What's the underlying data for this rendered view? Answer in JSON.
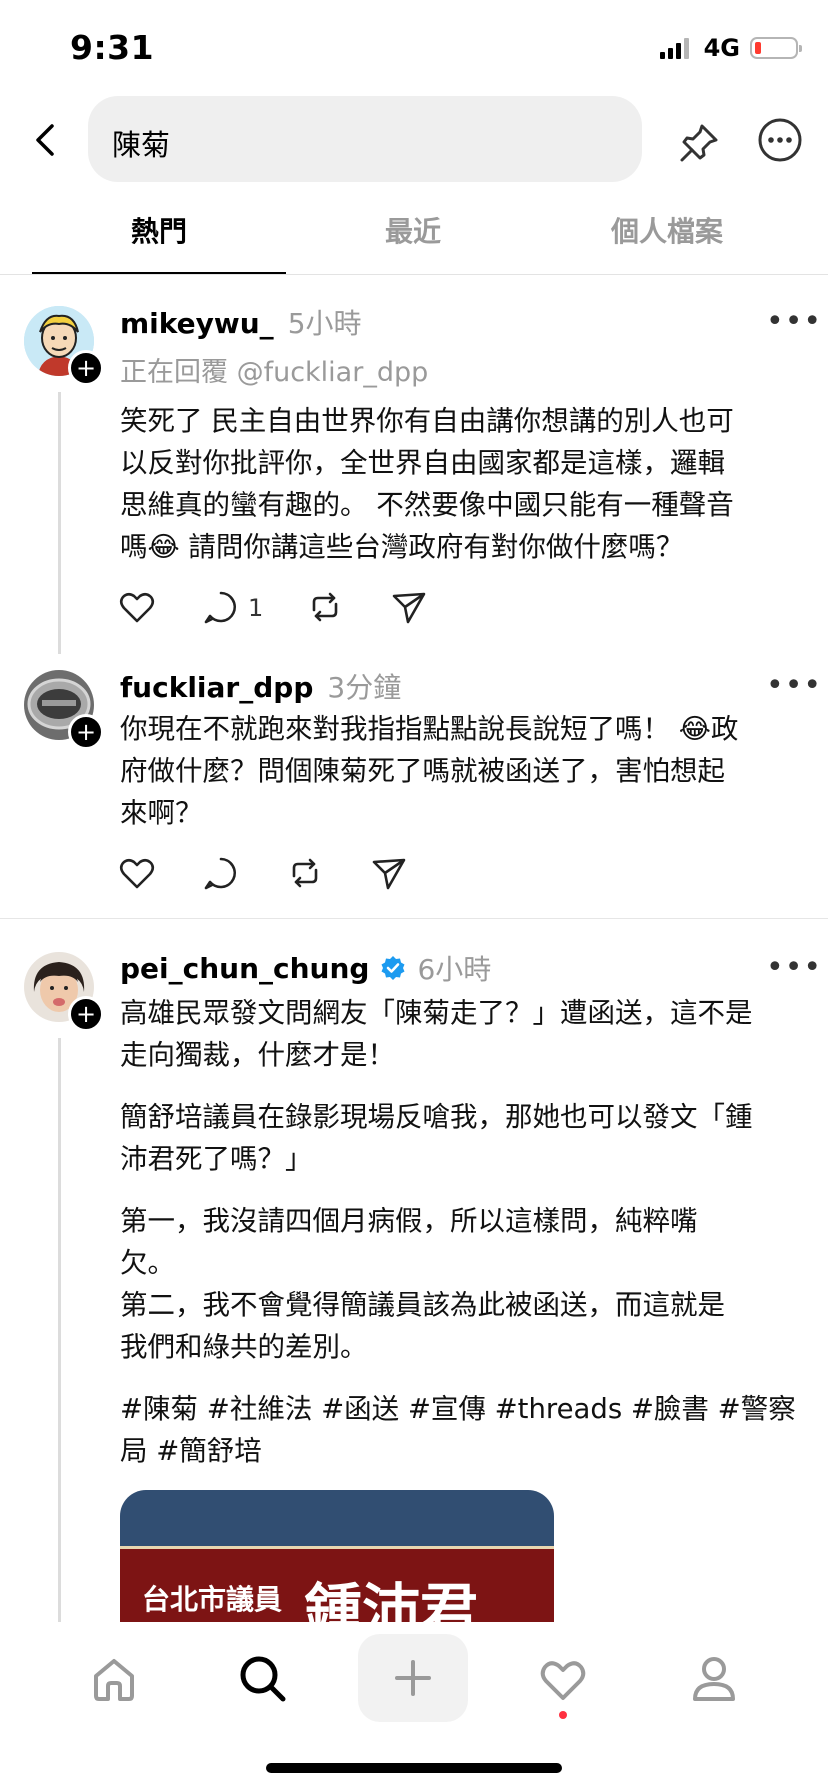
{
  "status_bar": {
    "time": "9:31",
    "network": "4G"
  },
  "search": {
    "query": "陳菊"
  },
  "tabs": [
    {
      "label": "熱門"
    },
    {
      "label": "最近"
    },
    {
      "label": "個人檔案"
    }
  ],
  "posts": [
    {
      "username": "mikeywu_",
      "time": "5小時",
      "replying_to": "正在回覆 @fuckliar_dpp",
      "lines": [
        "笑死了 民主自由世界你有自由講你想講的別人也可",
        "以反對你批評你，全世界自由國家都是這樣，邏輯",
        "思維真的蠻有趣的。  不然要像中國只能有一種聲音",
        "嗎",
        "😂",
        " 請問你講這些台灣政府有對你做什麼嗎？"
      ],
      "reply_count": "1"
    },
    {
      "username": "fuckliar_dpp",
      "time": "3分鐘",
      "lines": [
        "你現在不就跑來對我指指點點說長說短了嗎！ ",
        "😂",
        "政",
        "府做什麼？問個陳菊死了嗎就被函送了，害怕想起",
        "來啊？"
      ]
    },
    {
      "username": "pei_chun_chung",
      "time": "6小時",
      "paragraphs": [
        "高雄民眾發文問網友「陳菊走了？」遭函送，這不是",
        "走向獨裁，什麼才是！",
        "簡舒培議員在錄影現場反嗆我，那她也可以發文「鍾",
        "沛君死了嗎？」",
        "第一，我沒請四個月病假，所以這樣問，純粹嘴",
        "欠。",
        "第二，我不會覺得簡議員該為此被函送，而這就是",
        "我們和綠共的差別。",
        "#陳菊 #社維法 #函送 #宣傳 #threads #臉書 #警察",
        "局 #簡舒培"
      ],
      "image_text": {
        "left": "台北市議員",
        "right": "鍾沛君"
      }
    }
  ],
  "icons": {
    "back": "chevron-left-icon",
    "pin": "pin-icon",
    "more": "more-circle-icon",
    "like": "heart-icon",
    "reply": "comment-icon",
    "repost": "repost-icon",
    "share": "send-icon",
    "home": "home-icon",
    "search": "search-icon",
    "compose": "plus-icon",
    "activity": "heart-icon",
    "profile": "profile-icon",
    "verified": "verified-badge-icon"
  },
  "colors": {
    "verified": "#1d9bf0",
    "notification_dot": "#ff3040",
    "thread_line": "#dcdcdc"
  }
}
